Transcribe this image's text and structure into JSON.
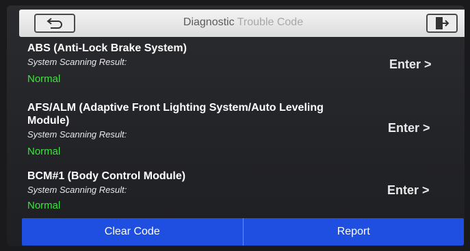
{
  "header": {
    "title_main": "Diagnostic",
    "title_fade": "Trouble Code"
  },
  "items": [
    {
      "name": "ABS (Anti-Lock Brake System)",
      "sub": "System Scanning Result:",
      "status": "Normal",
      "enter": "Enter >"
    },
    {
      "name": "AFS/ALM (Adaptive Front Lighting System/Auto Leveling Module)",
      "sub": "System Scanning Result:",
      "status": "Normal",
      "enter": "Enter >"
    },
    {
      "name": "BCM#1 (Body Control Module)",
      "sub": "System Scanning Result:",
      "status": "Normal",
      "enter": "Enter >"
    }
  ],
  "footer": {
    "clear_label": "Clear Code",
    "report_label": "Report"
  },
  "colors": {
    "status_normal": "#3fe33f",
    "bottom_bar": "#1f4fe0"
  }
}
